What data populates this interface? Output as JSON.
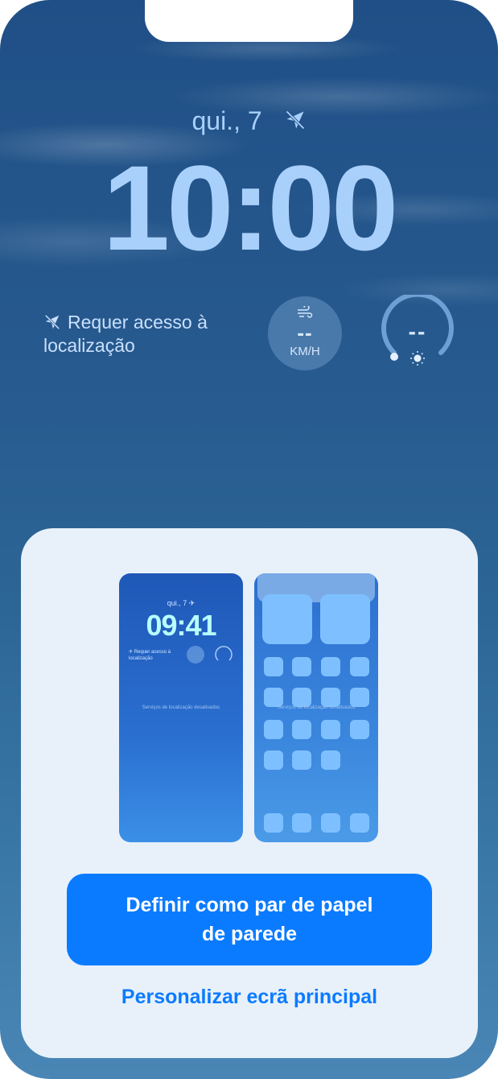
{
  "lock_screen": {
    "date": "qui., 7",
    "time": "10:00",
    "location_widget": {
      "text": "Requer acesso à localização",
      "icon": "location-disabled-icon"
    },
    "wind_widget": {
      "value": "--",
      "unit": "KM/H",
      "icon": "wind-icon"
    },
    "uv_widget": {
      "value": "--",
      "icon": "sun-icon"
    }
  },
  "sheet": {
    "lock_preview": {
      "date": "qui., 7",
      "time": "09:41",
      "location_text": "Requer acesso à localização",
      "services_text": "Serviços de localização desativados"
    },
    "home_preview": {
      "services_text": "Serviços de localização desativados"
    },
    "primary_button": "Definir como par de papel de parede",
    "secondary_button": "Personalizar ecrã principal"
  },
  "colors": {
    "accent": "#0a7bff",
    "sheet_background": "#e8f1fa",
    "lock_text": "#a9d0fb"
  }
}
